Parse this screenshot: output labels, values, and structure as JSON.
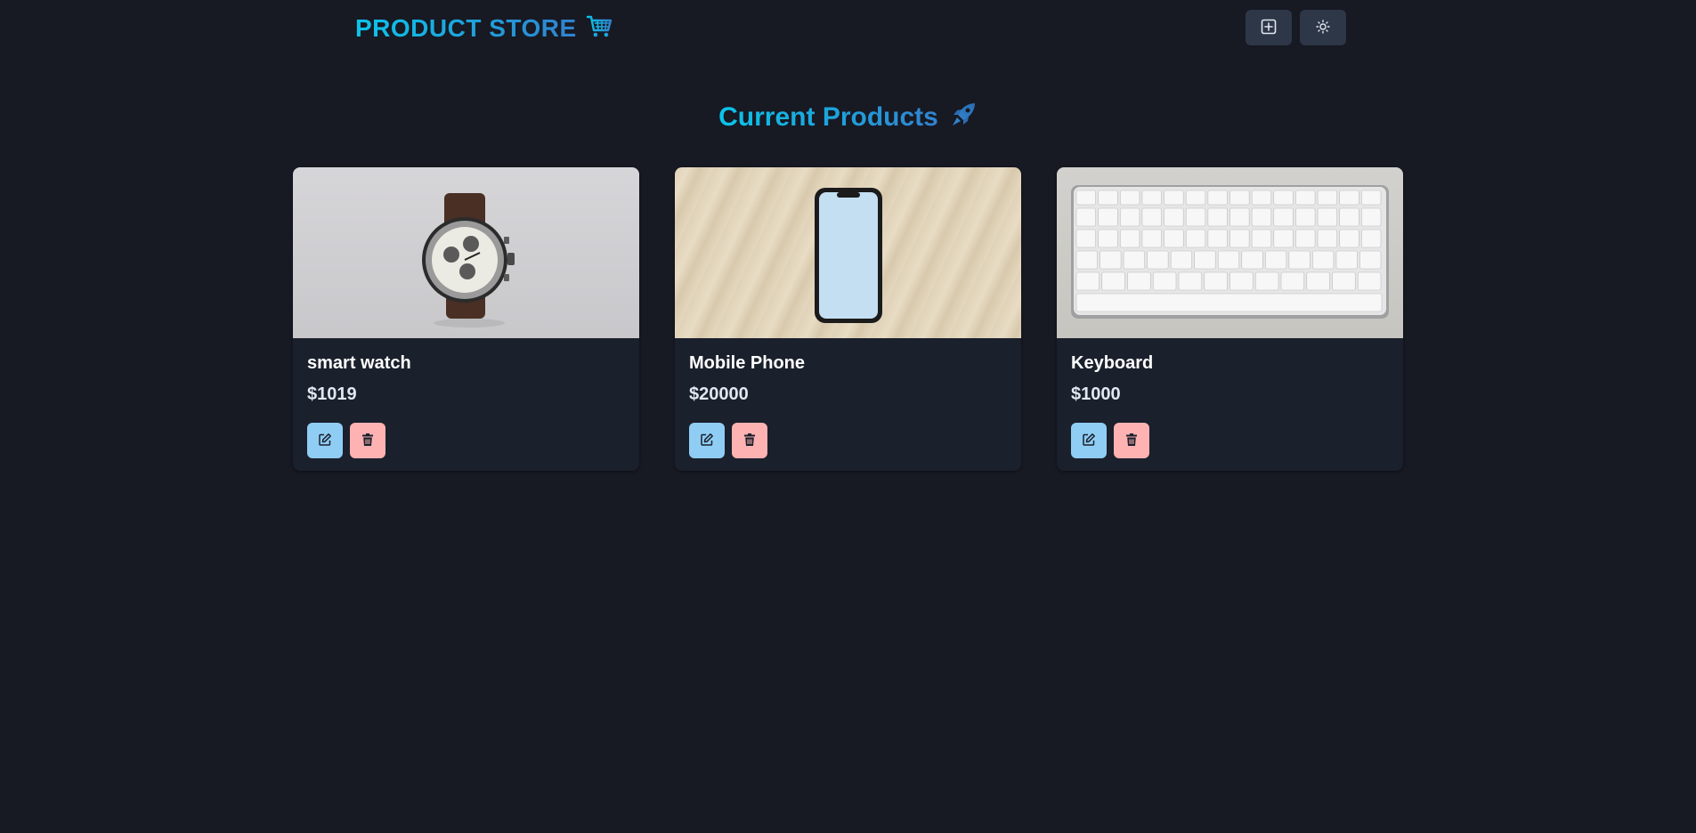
{
  "brand": {
    "title": "PRODUCT STORE",
    "icon": "shopping-cart-icon"
  },
  "nav": {
    "create_icon": "plus-square-icon",
    "theme_icon": "sun-icon"
  },
  "page": {
    "heading": "Current Products",
    "heading_icon": "rocket-icon"
  },
  "colors": {
    "background": "#171923",
    "card": "#1a202c",
    "accent_gradient_start": "#0bc5ea",
    "accent_gradient_end": "#3182ce",
    "edit_button": "#90cdf4",
    "delete_button": "#feb2b2"
  },
  "products": [
    {
      "name": "smart watch",
      "price": "$1019",
      "image": "wristwatch-photo",
      "edit_icon": "edit-icon",
      "delete_icon": "trash-icon"
    },
    {
      "name": "Mobile Phone",
      "price": "$20000",
      "image": "smartphone-photo",
      "edit_icon": "edit-icon",
      "delete_icon": "trash-icon"
    },
    {
      "name": "Keyboard",
      "price": "$1000",
      "image": "keyboard-photo",
      "edit_icon": "edit-icon",
      "delete_icon": "trash-icon"
    }
  ]
}
